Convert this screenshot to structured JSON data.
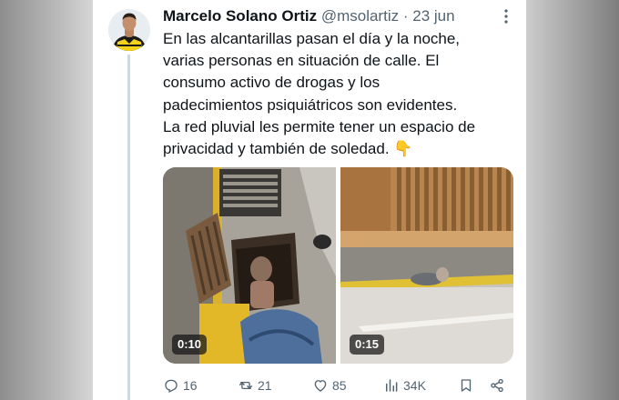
{
  "tweet": {
    "author_name": "Marcelo Solano Ortiz",
    "handle": "@msolartiz",
    "separator": "·",
    "date": "23 jun",
    "text_lines": [
      "En las alcantarillas pasan el día y la noche,",
      "varias personas  en situación de calle. El",
      "consumo activo de drogas y los",
      "padecimientos psiquiátricos son evidentes.",
      "La red pluvial les permite tener un espacio de",
      "privacidad y también de soledad. 👇"
    ],
    "videos": [
      {
        "duration": "0:10"
      },
      {
        "duration": "0:15"
      }
    ],
    "actions": {
      "replies": "16",
      "retweets": "21",
      "likes": "85",
      "views": "34K"
    }
  },
  "icons": {
    "more": "more-icon",
    "reply": "reply-icon",
    "retweet": "retweet-icon",
    "like": "heart-icon",
    "views": "views-icon",
    "bookmark": "bookmark-icon",
    "share": "share-icon"
  },
  "colors": {
    "text": "#0f1419",
    "muted": "#536471",
    "thread_line": "#cfd9de"
  }
}
